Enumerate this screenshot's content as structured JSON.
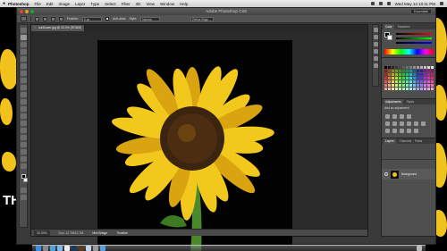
{
  "menubar": {
    "app": "Photoshop",
    "items": [
      "File",
      "Edit",
      "Image",
      "Layer",
      "Type",
      "Select",
      "Filter",
      "3D",
      "View",
      "Window",
      "Help"
    ],
    "clock": "Wed May 14  10:11 PM"
  },
  "window": {
    "title": "Adobe Photoshop CS6",
    "workspace": "Essentials"
  },
  "options": {
    "feather_label": "Feather:",
    "feather_value": "0 px",
    "antialias_label": "Anti-alias",
    "style_label": "Style:",
    "style_value": "Normal",
    "refine_label": "Refine Edge..."
  },
  "document": {
    "tab_title": "sunflower.jpg @ 33.3% (RGB/8)",
    "status_zoom": "33.33%",
    "status_doc": "Doc: 12.7M/12.7M",
    "bottom_tabs": [
      "Mini Bridge",
      "Timeline"
    ]
  },
  "panels": {
    "color_tabs": [
      "Color",
      "Swatches"
    ],
    "adjust_tabs": [
      "Adjustments",
      "Styles"
    ],
    "adjust_title": "Add an adjustment",
    "layers_tabs": [
      "Layers",
      "Channels",
      "Paths"
    ],
    "layer_name": "Background"
  },
  "wallpaper": {
    "text": "THE"
  },
  "colors": {
    "petal": "#f2c81d",
    "petal_dark": "#d9a40f",
    "center": "#3b2410",
    "stem": "#4a8a2a"
  }
}
